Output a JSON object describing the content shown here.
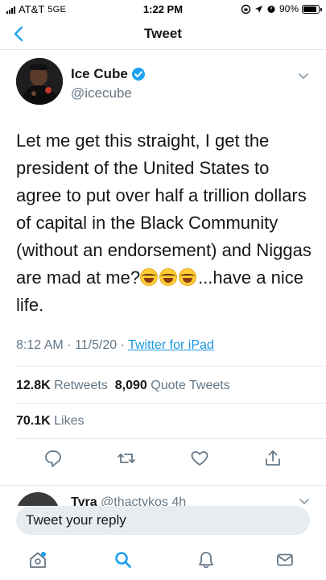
{
  "status_bar": {
    "carrier": "AT&T",
    "network": "5GE",
    "time": "1:22 PM",
    "battery": "90%",
    "battery_level": 0.9
  },
  "nav": {
    "title": "Tweet",
    "back_icon": "chevron-left-icon"
  },
  "tweet": {
    "author_name": "Ice Cube",
    "author_handle": "@icecube",
    "verified": true,
    "text_main": "Let me get this straight, I get the president of the United States to agree to put over half a trillion dollars of capital in the Black Community (without an endorsement) and Niggas are mad at me?",
    "text_tail": "...have a nice life.",
    "emoji": "face-with-tears-of-joy",
    "emoji_count": 3,
    "time": "8:12 AM",
    "date": "11/5/20",
    "meta_sep": "·",
    "source": "Twitter for iPad"
  },
  "stats": {
    "retweets_count": "12.8K",
    "retweets_label": "Retweets",
    "quotes_count": "8,090",
    "quotes_label": "Quote Tweets",
    "likes_count": "70.1K",
    "likes_label": "Likes"
  },
  "actions": [
    "reply-icon",
    "retweet-icon",
    "like-icon",
    "share-icon"
  ],
  "next_reply": {
    "name": "Tyra",
    "handle": "@thactykos",
    "age": "4h"
  },
  "reply_box": {
    "placeholder": "Tweet your reply"
  },
  "tabbar": [
    "home-icon",
    "search-icon",
    "notifications-icon",
    "messages-icon"
  ],
  "colors": {
    "accent": "#1da1f2",
    "link": "#1b95e0",
    "secondary_text": "#657786",
    "divider": "#e1e8ed"
  }
}
